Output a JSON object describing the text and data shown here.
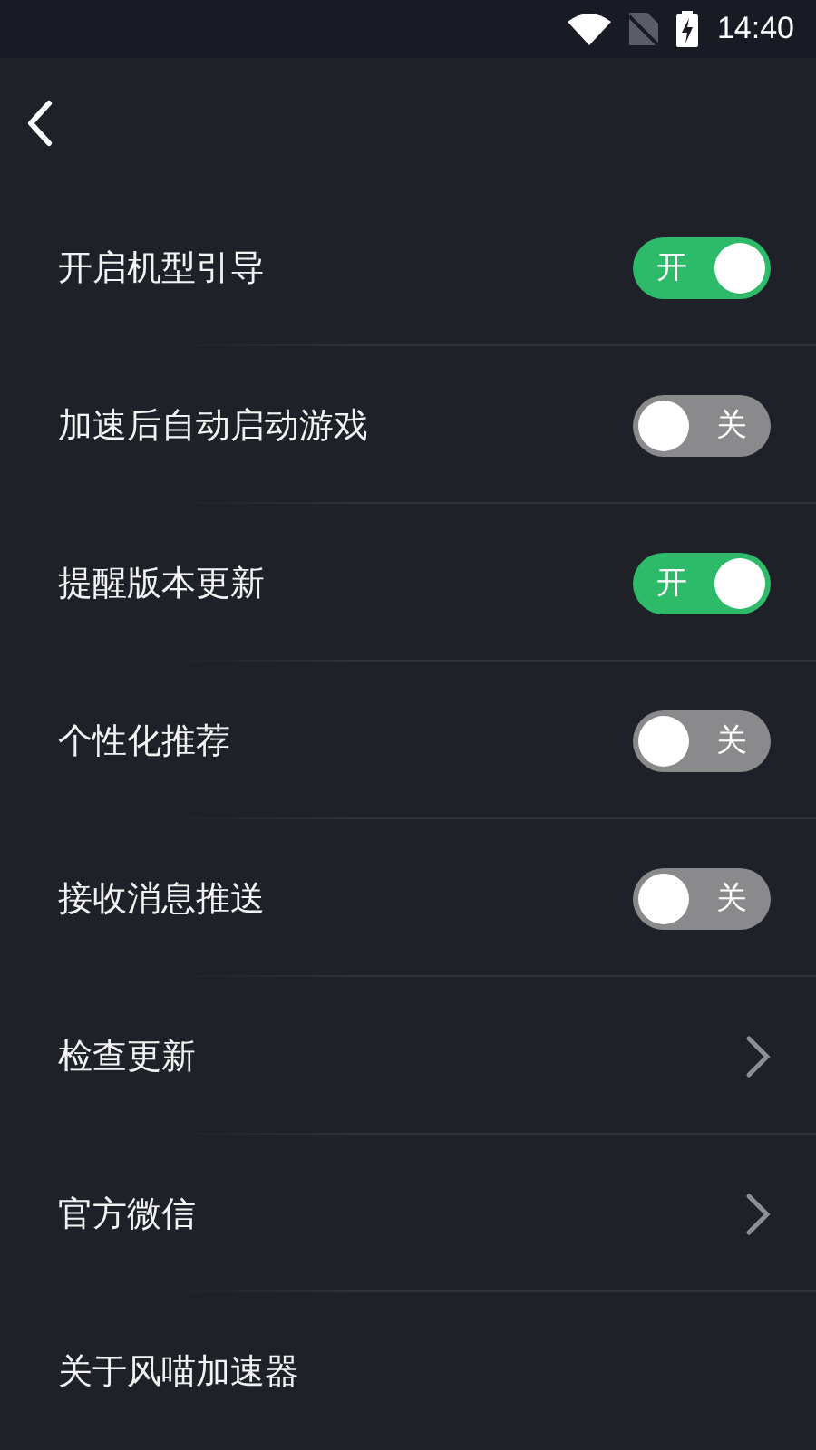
{
  "status_bar": {
    "time": "14:40"
  },
  "settings": [
    {
      "label": "开启机型引导",
      "kind": "toggle",
      "on": true,
      "text": "开"
    },
    {
      "label": "加速后自动启动游戏",
      "kind": "toggle",
      "on": false,
      "text": "关"
    },
    {
      "label": "提醒版本更新",
      "kind": "toggle",
      "on": true,
      "text": "开"
    },
    {
      "label": "个性化推荐",
      "kind": "toggle",
      "on": false,
      "text": "关"
    },
    {
      "label": "接收消息推送",
      "kind": "toggle",
      "on": false,
      "text": "关"
    },
    {
      "label": "检查更新",
      "kind": "link"
    },
    {
      "label": "官方微信",
      "kind": "link"
    },
    {
      "label": "关于风喵加速器",
      "kind": "plain"
    }
  ]
}
